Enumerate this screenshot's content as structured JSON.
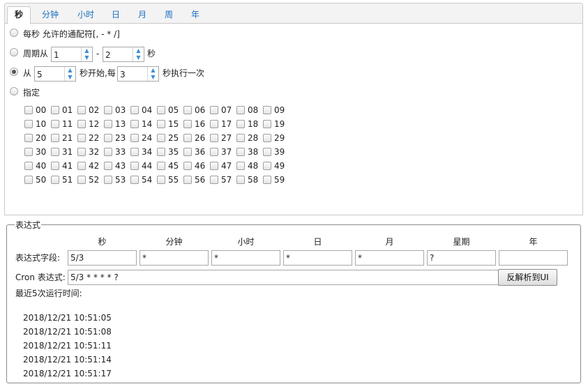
{
  "tabs": [
    {
      "label": "秒",
      "active": true
    },
    {
      "label": "分钟",
      "active": false
    },
    {
      "label": "小时",
      "active": false
    },
    {
      "label": "日",
      "active": false
    },
    {
      "label": "月",
      "active": false
    },
    {
      "label": "周",
      "active": false
    },
    {
      "label": "年",
      "active": false
    }
  ],
  "options": {
    "every": {
      "label": "每秒 允许的通配符[, - * /]",
      "checked": false
    },
    "cycle": {
      "prefix": "周期从",
      "from": "1",
      "sep": "-",
      "to": "2",
      "suffix": "秒",
      "checked": false
    },
    "start": {
      "prefix": "从",
      "start": "5",
      "mid": "秒开始,每",
      "step": "3",
      "suffix": "秒执行一次",
      "checked": true
    },
    "specify": {
      "label": "指定",
      "checked": false
    }
  },
  "seconds": [
    "00",
    "01",
    "02",
    "03",
    "04",
    "05",
    "06",
    "07",
    "08",
    "09",
    "10",
    "11",
    "12",
    "13",
    "14",
    "15",
    "16",
    "17",
    "18",
    "19",
    "20",
    "21",
    "22",
    "23",
    "24",
    "25",
    "26",
    "27",
    "28",
    "29",
    "30",
    "31",
    "32",
    "33",
    "34",
    "35",
    "36",
    "37",
    "38",
    "39",
    "40",
    "41",
    "42",
    "43",
    "44",
    "45",
    "46",
    "47",
    "48",
    "49",
    "50",
    "51",
    "52",
    "53",
    "54",
    "55",
    "56",
    "57",
    "58",
    "59"
  ],
  "expression": {
    "legend": "表达式",
    "columns": [
      "秒",
      "分钟",
      "小时",
      "日",
      "月",
      "星期",
      "年"
    ],
    "field_label": "表达式字段:",
    "fields": [
      "5/3",
      "*",
      "*",
      "*",
      "*",
      "?",
      ""
    ],
    "cron_label": "Cron 表达式:",
    "cron_value": "5/3 * * * * ?",
    "parse_button": "反解析到UI",
    "recent_label": "最近5次运行时间:",
    "recent_runs": [
      "2018/12/21 10:51:05",
      "2018/12/21 10:51:08",
      "2018/12/21 10:51:11",
      "2018/12/21 10:51:14",
      "2018/12/21 10:51:17"
    ]
  },
  "colors": {
    "tab_link": "#1a6fc0",
    "spinner_arrow": "#3a8fd8"
  }
}
